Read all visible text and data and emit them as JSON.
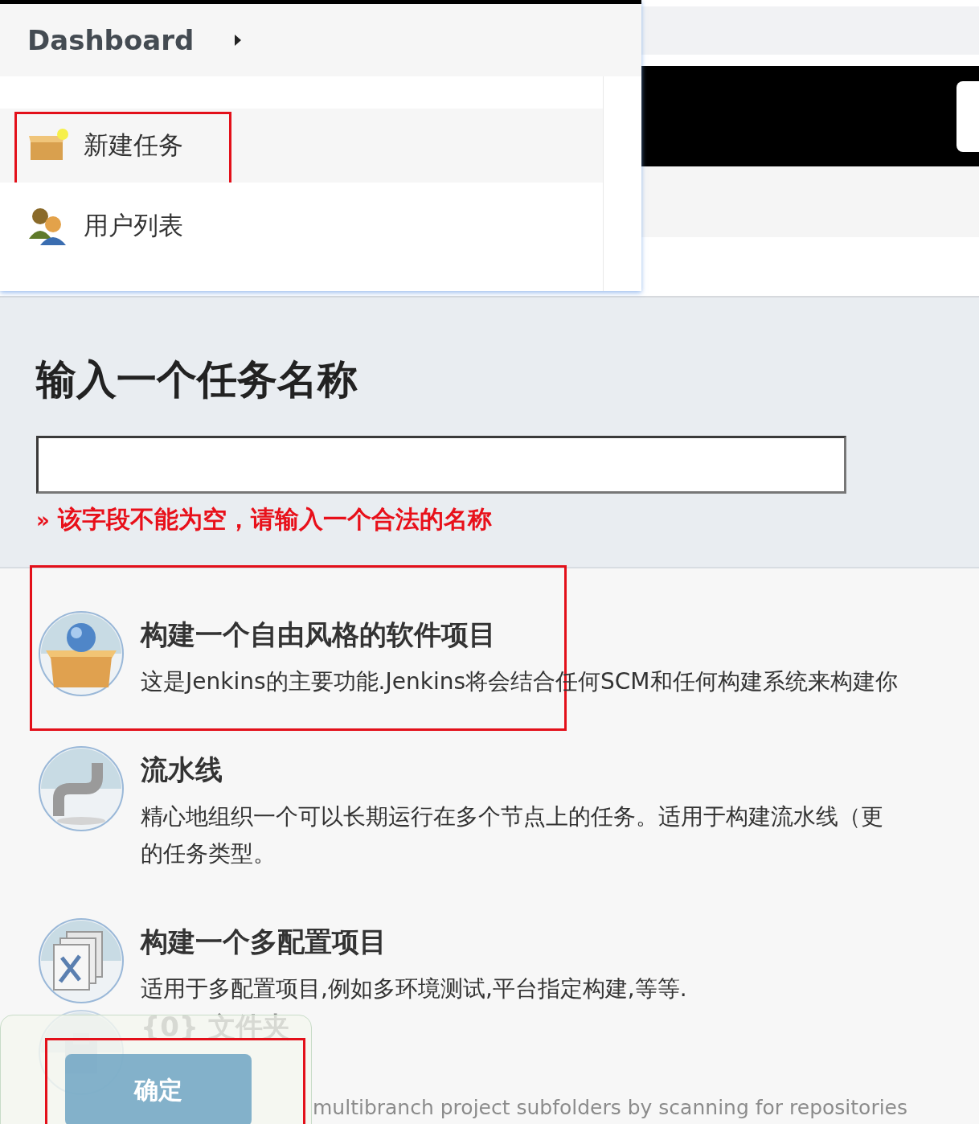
{
  "menu": {
    "title": "Dashboard",
    "items": [
      {
        "kind": "new-task",
        "label": "新建任务",
        "highlighted": true
      },
      {
        "kind": "users",
        "label": "用户列表",
        "highlighted": false
      }
    ]
  },
  "form": {
    "heading": "输入一个任务名称",
    "error_marker": "»",
    "error": "该字段不能为空，请输入一个合法的名称"
  },
  "item_types": [
    {
      "kind": "freestyle",
      "title": "构建一个自由风格的软件项目",
      "description_lines": [
        "这是Jenkins的主要功能.Jenkins将会结合任何SCM和任何构建系统来构建你"
      ],
      "highlighted": true
    },
    {
      "kind": "pipeline",
      "title": "流水线",
      "description_lines": [
        "精心地组织一个可以长期运行在多个节点上的任务。适用于构建流水线（更",
        "的任务类型。"
      ],
      "highlighted": false
    },
    {
      "kind": "multiconfig",
      "title": "构建一个多配置项目",
      "description_lines": [
        "适用于多配置项目,例如多环境测试,平台指定构建,等等."
      ],
      "highlighted": false
    },
    {
      "kind": "folder",
      "title": "{0} 文件夹",
      "description_lines": [
        "multibranch project subfolders by scanning for repositories"
      ],
      "highlighted": false
    }
  ],
  "ok_button": {
    "label": "确定",
    "highlighted": true
  }
}
